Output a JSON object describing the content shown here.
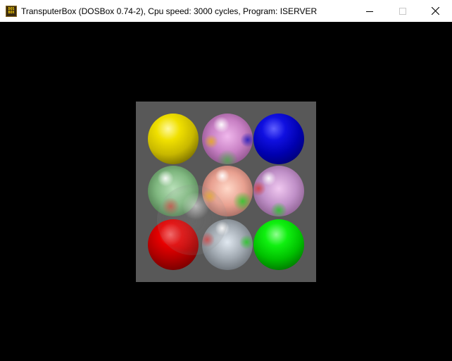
{
  "window": {
    "title": "TransputerBox (DOSBox 0.74-2), Cpu speed: 3000 cycles, Program: ISERVER",
    "app_icon": "dosbox-icon",
    "app_icon_text": [
      "DOS",
      "BOX"
    ],
    "controls": {
      "minimize_icon": "minimize-icon",
      "maximize_icon": "maximize-icon",
      "close_icon": "close-icon"
    }
  },
  "scene": {
    "background_color": "#000000",
    "panel_color": "#585858",
    "spheres": [
      {
        "name": "yellow-sphere",
        "color": "#e8d800",
        "finish": "matte"
      },
      {
        "name": "pink-glass-sphere",
        "color": "#d080c8",
        "finish": "glass"
      },
      {
        "name": "blue-sphere",
        "color": "#0000d0",
        "finish": "matte"
      },
      {
        "name": "green-glass-sphere",
        "color": "#80c080",
        "finish": "glass"
      },
      {
        "name": "peach-glass-sphere",
        "color": "#e8a090",
        "finish": "glass"
      },
      {
        "name": "lavender-glass-sphere",
        "color": "#c090c8",
        "finish": "glass"
      },
      {
        "name": "red-sphere",
        "color": "#d00000",
        "finish": "matte"
      },
      {
        "name": "silver-glass-sphere",
        "color": "#a0a8b0",
        "finish": "glass"
      },
      {
        "name": "green-sphere",
        "color": "#00d000",
        "finish": "matte"
      },
      {
        "name": "clear-glass-sphere",
        "color": "#d0d0d0",
        "finish": "clear"
      }
    ]
  }
}
